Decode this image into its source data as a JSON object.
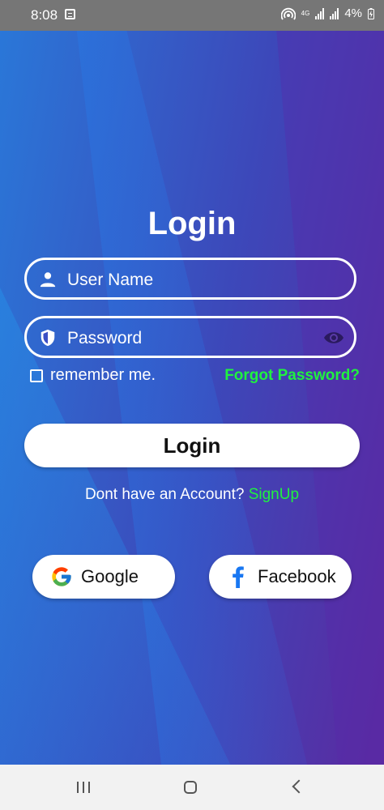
{
  "status_bar": {
    "time": "8:08",
    "network": "4G",
    "battery": "4%"
  },
  "login": {
    "title": "Login",
    "username_placeholder": "User Name",
    "password_placeholder": "Password",
    "remember_label": "remember me.",
    "forgot_label": "Forgot Password?",
    "login_button": "Login",
    "signup_prompt": "Dont have an Account?",
    "signup_link": "SignUp",
    "google_button": "Google",
    "facebook_button": "Facebook"
  },
  "colors": {
    "accent_green": "#1ff23f",
    "gradient_start": "#2a77d8",
    "gradient_end": "#5b2aa0"
  },
  "icons": {
    "username": "person-icon",
    "password": "shield-icon",
    "toggle_visibility": "eye-icon",
    "google": "google-icon",
    "facebook": "facebook-icon"
  }
}
